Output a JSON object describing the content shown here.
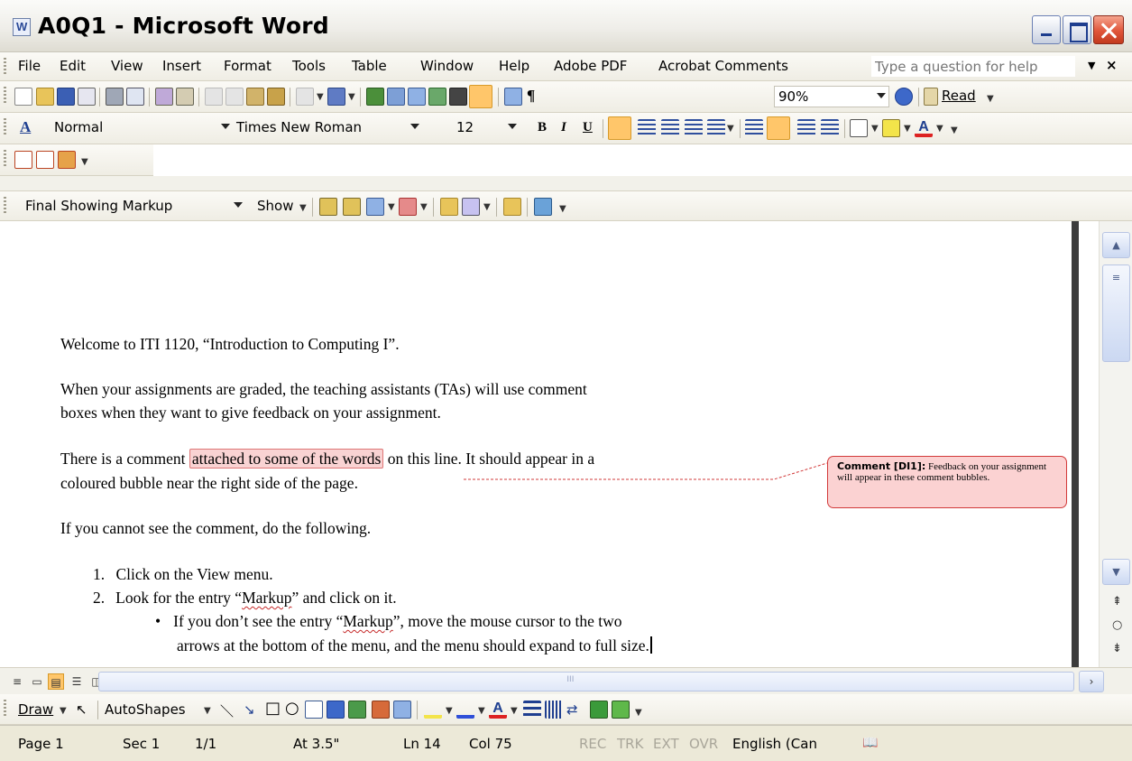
{
  "window": {
    "title": "A0Q1 - Microsoft Word"
  },
  "menubar": {
    "items": [
      {
        "label": "File"
      },
      {
        "label": "Edit"
      },
      {
        "label": "View"
      },
      {
        "label": "Insert"
      },
      {
        "label": "Format"
      },
      {
        "label": "Tools"
      },
      {
        "label": "Table"
      },
      {
        "label": "Window"
      },
      {
        "label": "Help"
      },
      {
        "label": "Adobe PDF"
      },
      {
        "label": "Acrobat Comments"
      }
    ],
    "help_placeholder": "Type a question for help"
  },
  "standard_toolbar": {
    "zoom": "90%",
    "read_label": "Read"
  },
  "formatting_toolbar": {
    "style": "Normal",
    "font": "Times New Roman",
    "size": "12",
    "bold": "B",
    "italic": "I",
    "underline": "U"
  },
  "reviewing_toolbar": {
    "display_mode": "Final Showing Markup",
    "show_label": "Show"
  },
  "document": {
    "paragraphs": [
      "Welcome to ITI 1120, “Introduction to Computing I”.",
      "When your assignments are graded, the teaching assistants (TAs) will use comment",
      "boxes when they want to give feedback on your assignment.",
      "There is a comment",
      "attached to some of the words",
      "on this line.  It should appear in a",
      "coloured bubble near the right side of the page.",
      "If you cannot see the comment, do the following."
    ],
    "list": [
      {
        "num": "1.",
        "text": "Click on the View menu."
      },
      {
        "num": "2.",
        "text_before": "Look for the entry “",
        "word": "Markup",
        "text_after": "” and click on it."
      }
    ],
    "bullet": {
      "mark": "•",
      "line1_before": "If you don’t see the entry “",
      "line1_word": "Markup",
      "line1_after": "”, move the mouse cursor to the two",
      "line2": "arrows at the bottom of the menu, and the menu should expand to full size."
    },
    "comment": {
      "label": "Comment [DI1]:",
      "text": "Feedback on your assignment will appear in these comment bubbles.",
      "color": "#fbd2d2",
      "border": "#d23a3a"
    }
  },
  "drawing_toolbar": {
    "draw_label": "Draw",
    "autoshapes_label": "AutoShapes"
  },
  "statusbar": {
    "page": "Page 1",
    "section": "Sec 1",
    "pages": "1/1",
    "at": "At 3.5\"",
    "line": "Ln 14",
    "col": "Col 75",
    "rec": "REC",
    "trk": "TRK",
    "ext": "EXT",
    "ovr": "OVR",
    "language": "English (Can"
  }
}
